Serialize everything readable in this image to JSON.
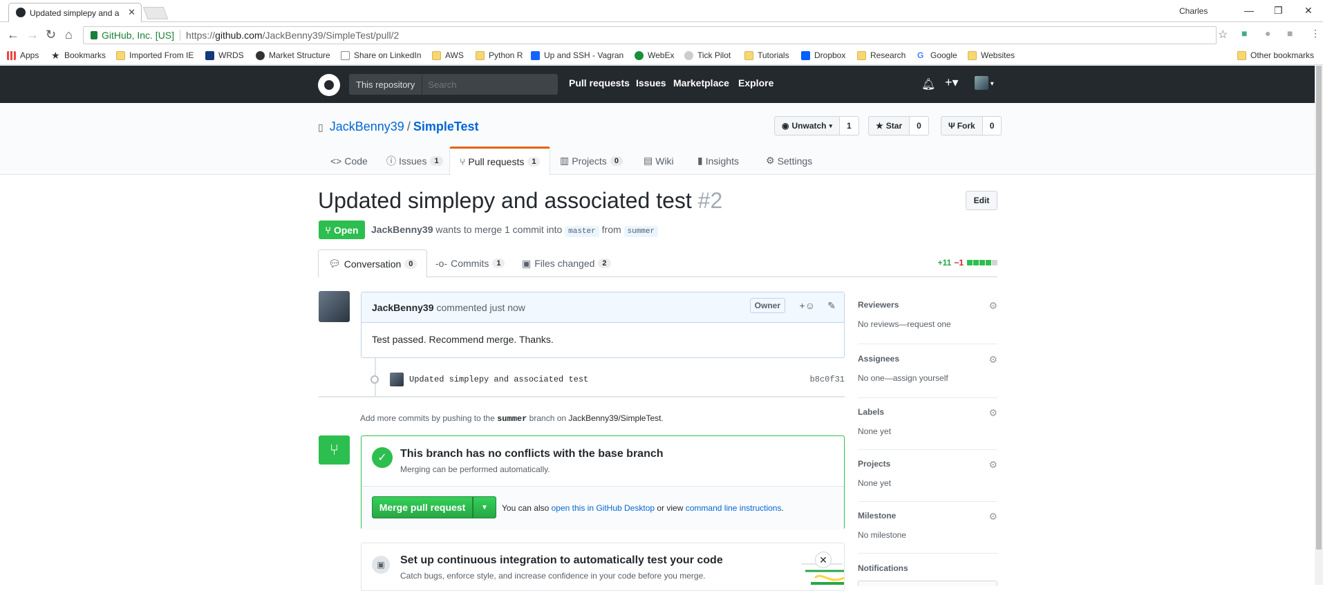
{
  "browser": {
    "tab_title": "Updated simplepy and a",
    "user": "Charles",
    "secure_label": "GitHub, Inc. [US]",
    "url_prefix": "https://",
    "url_host": "github.com",
    "url_path": "/JackBenny39/SimpleTest/pull/2",
    "bookmarks": [
      "Apps",
      "Bookmarks",
      "Imported From IE",
      "WRDS",
      "Market Structure",
      "Share on LinkedIn",
      "AWS",
      "Python R",
      "Up and SSH - Vagran",
      "WebEx",
      "Tick Pilot",
      "Tutorials",
      "Dropbox",
      "Research",
      "Google",
      "Websites"
    ],
    "other_bookmarks": "Other bookmarks"
  },
  "header": {
    "scope": "This repository",
    "search_placeholder": "Search",
    "nav": [
      "Pull requests",
      "Issues",
      "Marketplace",
      "Explore"
    ]
  },
  "repo": {
    "owner": "JackBenny39",
    "name": "SimpleTest",
    "watch_label": "Unwatch",
    "watch_count": "1",
    "star_label": "Star",
    "star_count": "0",
    "fork_label": "Fork",
    "fork_count": "0",
    "tabs": [
      {
        "label": "Code",
        "count": ""
      },
      {
        "label": "Issues",
        "count": "1"
      },
      {
        "label": "Pull requests",
        "count": "1"
      },
      {
        "label": "Projects",
        "count": "0"
      },
      {
        "label": "Wiki",
        "count": ""
      },
      {
        "label": "Insights",
        "count": ""
      },
      {
        "label": "Settings",
        "count": ""
      }
    ]
  },
  "pr": {
    "title": "Updated simplepy and associated test",
    "number": "#2",
    "edit_label": "Edit",
    "state": "Open",
    "author": "JackBenny39",
    "meta_text": "wants to merge 1 commit into",
    "base": "master",
    "from_text": "from",
    "head": "summer",
    "tabs": [
      {
        "label": "Conversation",
        "count": "0"
      },
      {
        "label": "Commits",
        "count": "1"
      },
      {
        "label": "Files changed",
        "count": "2"
      }
    ],
    "additions": "+11",
    "deletions": "−1"
  },
  "comment": {
    "author": "JackBenny39",
    "time": "commented just now",
    "badge": "Owner",
    "body": "Test passed. Recommend merge. Thanks."
  },
  "commit": {
    "message": "Updated simplepy and associated test",
    "sha": "b8c0f31"
  },
  "hint": {
    "pre": "Add more commits by pushing to the",
    "branch": "summer",
    "mid": "branch on",
    "repo": "JackBenny39/SimpleTest",
    "post": "."
  },
  "merge": {
    "title": "This branch has no conflicts with the base branch",
    "subtitle": "Merging can be performed automatically.",
    "button": "Merge pull request",
    "alt_pre": "You can also",
    "alt_link1": "open this in GitHub Desktop",
    "alt_mid": "or view",
    "alt_link2": "command line instructions",
    "alt_post": "."
  },
  "ci": {
    "title": "Set up continuous integration to automatically test your code",
    "subtitle": "Catch bugs, enforce style, and increase confidence in your code before you merge."
  },
  "sidebar": [
    {
      "heading": "Reviewers",
      "value": "No reviews—request one"
    },
    {
      "heading": "Assignees",
      "value": "No one—assign yourself"
    },
    {
      "heading": "Labels",
      "value": "None yet"
    },
    {
      "heading": "Projects",
      "value": "None yet"
    },
    {
      "heading": "Milestone",
      "value": "No milestone"
    },
    {
      "heading": "Notifications",
      "value": ""
    }
  ],
  "colors": {
    "green": "#2cbe4e",
    "accent_orange": "#e36209",
    "link": "#0366d6",
    "header_bg": "#24292e"
  }
}
